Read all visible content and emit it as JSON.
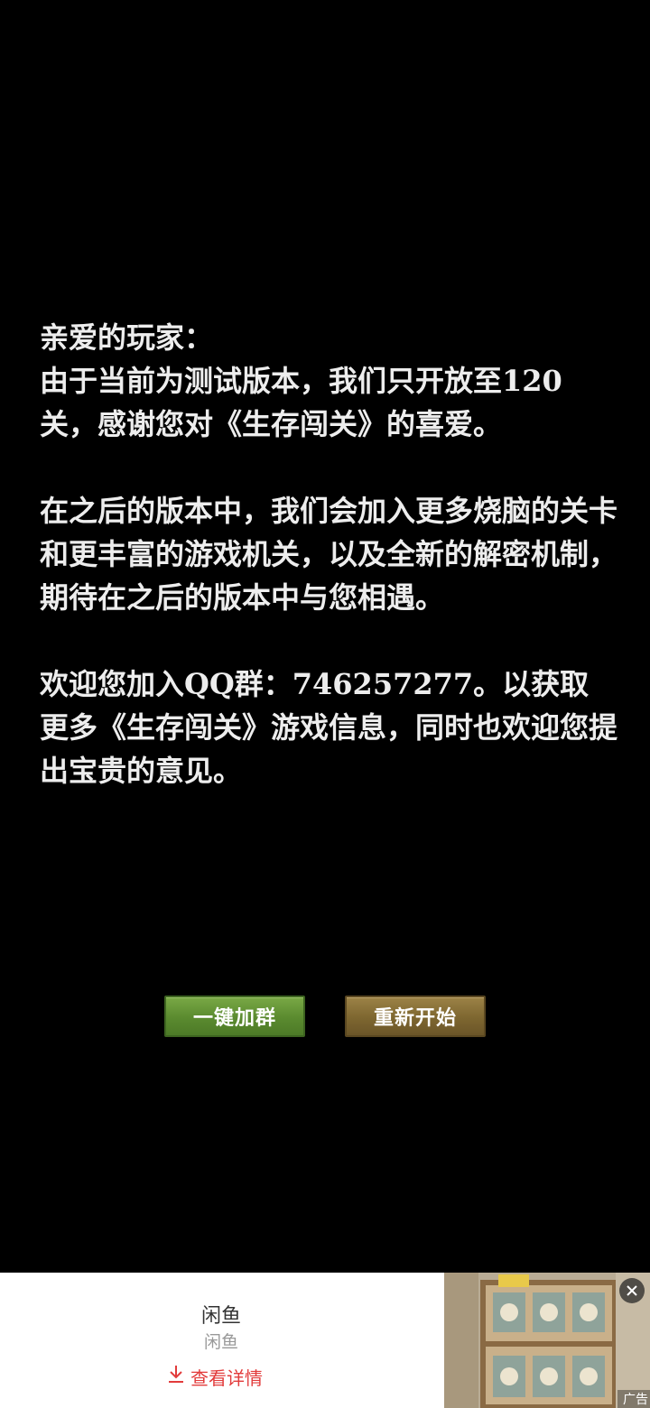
{
  "message": {
    "greeting": "亲爱的玩家：",
    "paragraph1": "由于当前为测试版本，我们只开放至120关，感谢您对《生存闯关》的喜爱。",
    "paragraph2": "在之后的版本中，我们会加入更多烧脑的关卡和更丰富的游戏机关，以及全新的解密机制，期待在之后的版本中与您相遇。",
    "paragraph3": "欢迎您加入QQ群：746257277。以获取更多《生存闯关》游戏信息，同时也欢迎您提出宝贵的意见。"
  },
  "buttons": {
    "join_group": "一键加群",
    "restart": "重新开始"
  },
  "colors": {
    "background": "#000000",
    "text": "#ededed",
    "join_button": "#5a8a2f",
    "restart_button": "#7d6630",
    "ad_link": "#e23b3b"
  },
  "ad": {
    "title": "闲鱼",
    "subtitle": "闲鱼",
    "detail_label": "查看详情",
    "tag": "广告",
    "close_icon": "close-icon",
    "download_icon": "download-icon"
  }
}
